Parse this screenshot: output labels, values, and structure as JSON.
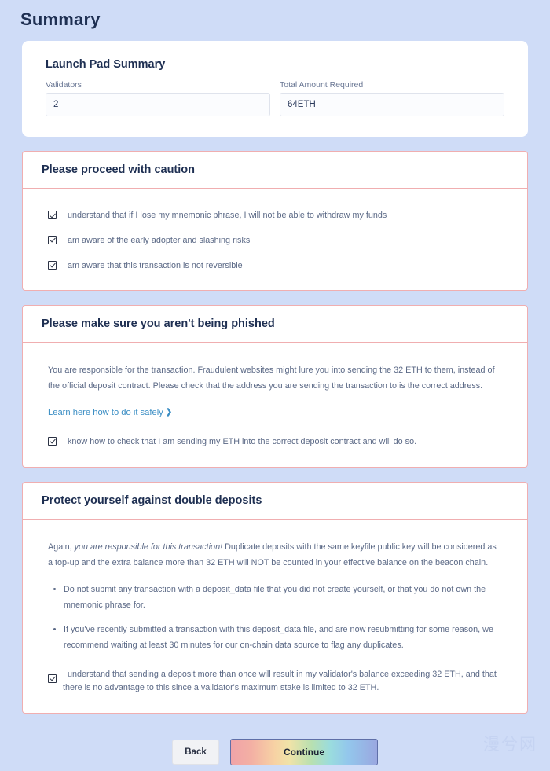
{
  "page": {
    "title": "Summary",
    "watermark": "漫兮网"
  },
  "summary": {
    "heading": "Launch Pad Summary",
    "fields": [
      {
        "label": "Validators",
        "value": "2"
      },
      {
        "label": "Total Amount Required",
        "value": "64ETH"
      }
    ]
  },
  "caution": {
    "header": "Please proceed with caution",
    "checks": [
      "I understand that if I lose my mnemonic phrase, I will not be able to withdraw my funds",
      "I am aware of the early adopter and slashing risks",
      "I am aware that this transaction is not reversible"
    ]
  },
  "phishing": {
    "header": "Please make sure you aren't being phished",
    "paragraph": "You are responsible for the transaction. Fraudulent websites might lure you into sending the 32 ETH to them, instead of the official deposit contract. Please check that the address you are sending the transaction to is the correct address.",
    "link_text": "Learn here how to do it safely",
    "link_chevron": "❯",
    "check": "I know how to check that I am sending my ETH into the correct deposit contract and will do so."
  },
  "double_deposits": {
    "header": "Protect yourself against double deposits",
    "paragraph_lead": "Again, ",
    "paragraph_italic": "you are responsible for this transaction!",
    "paragraph_rest": " Duplicate deposits with the same keyfile public key will be considered as a top-up and the extra balance more than 32 ETH will NOT be counted in your effective balance on the beacon chain.",
    "bullets": [
      "Do not submit any transaction with a deposit_data file that you did not create yourself, or that you do not own the mnemonic phrase for.",
      "If you've recently submitted a transaction with this deposit_data file, and are now resubmitting for some reason, we recommend waiting at least 30 minutes for our on-chain data source to flag any duplicates."
    ],
    "check": "I understand that sending a deposit more than once will result in my validator's balance exceeding 32 ETH, and that there is no advantage to this since a validator's maximum stake is limited to 32 ETH."
  },
  "footer": {
    "back_label": "Back",
    "continue_label": "Continue"
  },
  "colors": {
    "page_background": "#cfdcf7",
    "warning_border": "#f0aeb0",
    "link": "#3b8ec4",
    "heading": "#1e2f52",
    "body_text": "#5b6986"
  }
}
